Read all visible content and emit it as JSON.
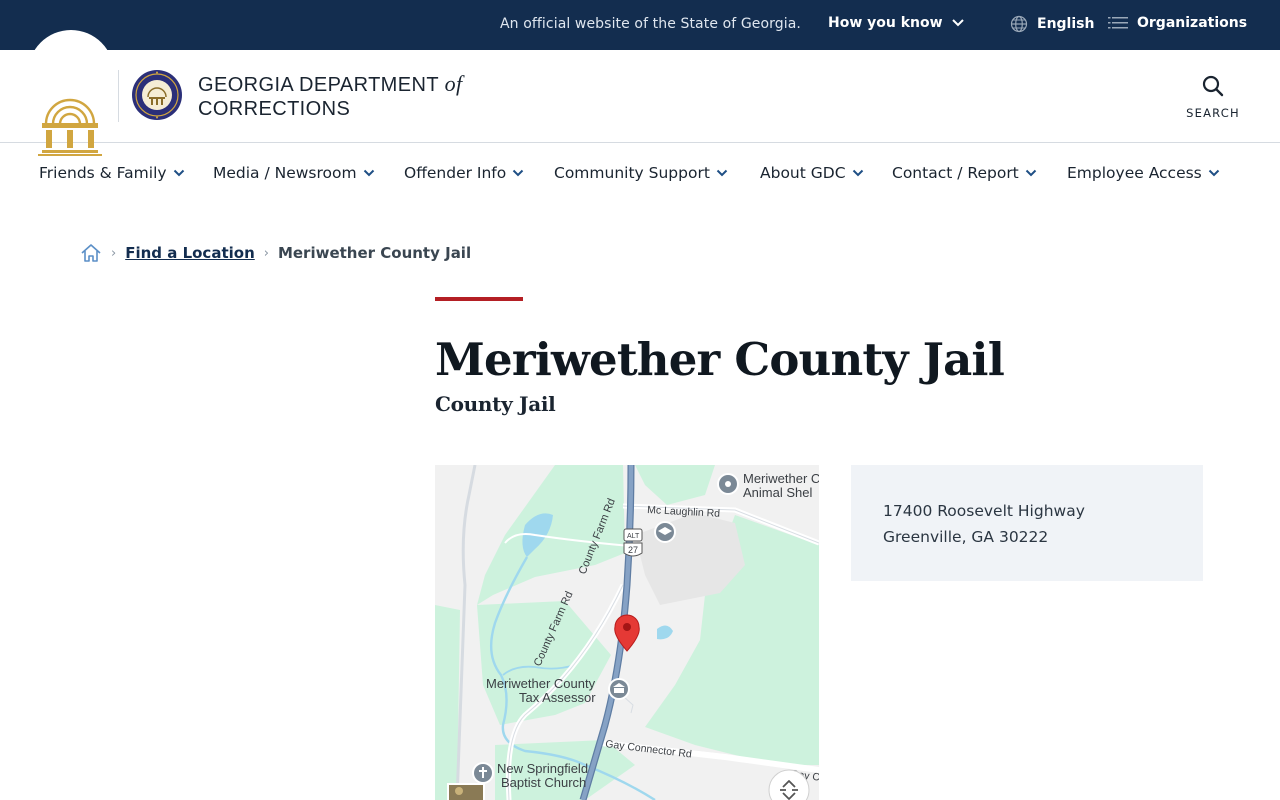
{
  "topbar": {
    "official_text": "An official website of the State of Georgia.",
    "how_you_know": "How you know",
    "language": "English",
    "organizations": "Organizations",
    "background_color": "#132d4f"
  },
  "header": {
    "agency_line1": "GEORGIA DEPARTMENT",
    "agency_of": "of",
    "agency_line2": "CORRECTIONS",
    "search_label": "SEARCH",
    "seal_color": "#d1a640",
    "gdc_seal_color": "#2b2f79"
  },
  "nav": {
    "items": [
      {
        "label": "Friends & Family"
      },
      {
        "label": "Media / Newsroom"
      },
      {
        "label": "Offender Info"
      },
      {
        "label": "Community Support"
      },
      {
        "label": "About GDC"
      },
      {
        "label": "Contact / Report"
      },
      {
        "label": "Employee Access"
      }
    ],
    "chevron_color": "#1f4f85"
  },
  "breadcrumb": {
    "home_icon": "home-icon",
    "link": "Find a Location",
    "current": "Meriwether County Jail"
  },
  "page": {
    "title": "Meriwether County Jail",
    "subtitle": "County Jail",
    "accent_color": "#b41f24"
  },
  "map": {
    "labels": {
      "animal_shelter_1": "Meriwether C",
      "animal_shelter_2": "Animal Shel",
      "mclaughlin_rd": "Mc Laughlin Rd",
      "county_farm_rd_upper": "County Farm Rd",
      "county_farm_rd_lower": "County Farm Rd",
      "tax_assessor_1": "Meriwether County",
      "tax_assessor_2": "Tax Assessor",
      "gay_connector_rd": "Gay Connector Rd",
      "gay_c": "Gay C",
      "church_1": "New Springfield",
      "church_2": "Baptist Church",
      "shield_alt": "ALT",
      "shield_num": "27"
    },
    "marker_color": "#e53935",
    "park_color": "#cdf2dd",
    "water_color": "#9fd8ee",
    "road_color": "#7f9cc0"
  },
  "address": {
    "line1": "17400 Roosevelt Highway",
    "line2": "Greenville, GA 30222"
  }
}
